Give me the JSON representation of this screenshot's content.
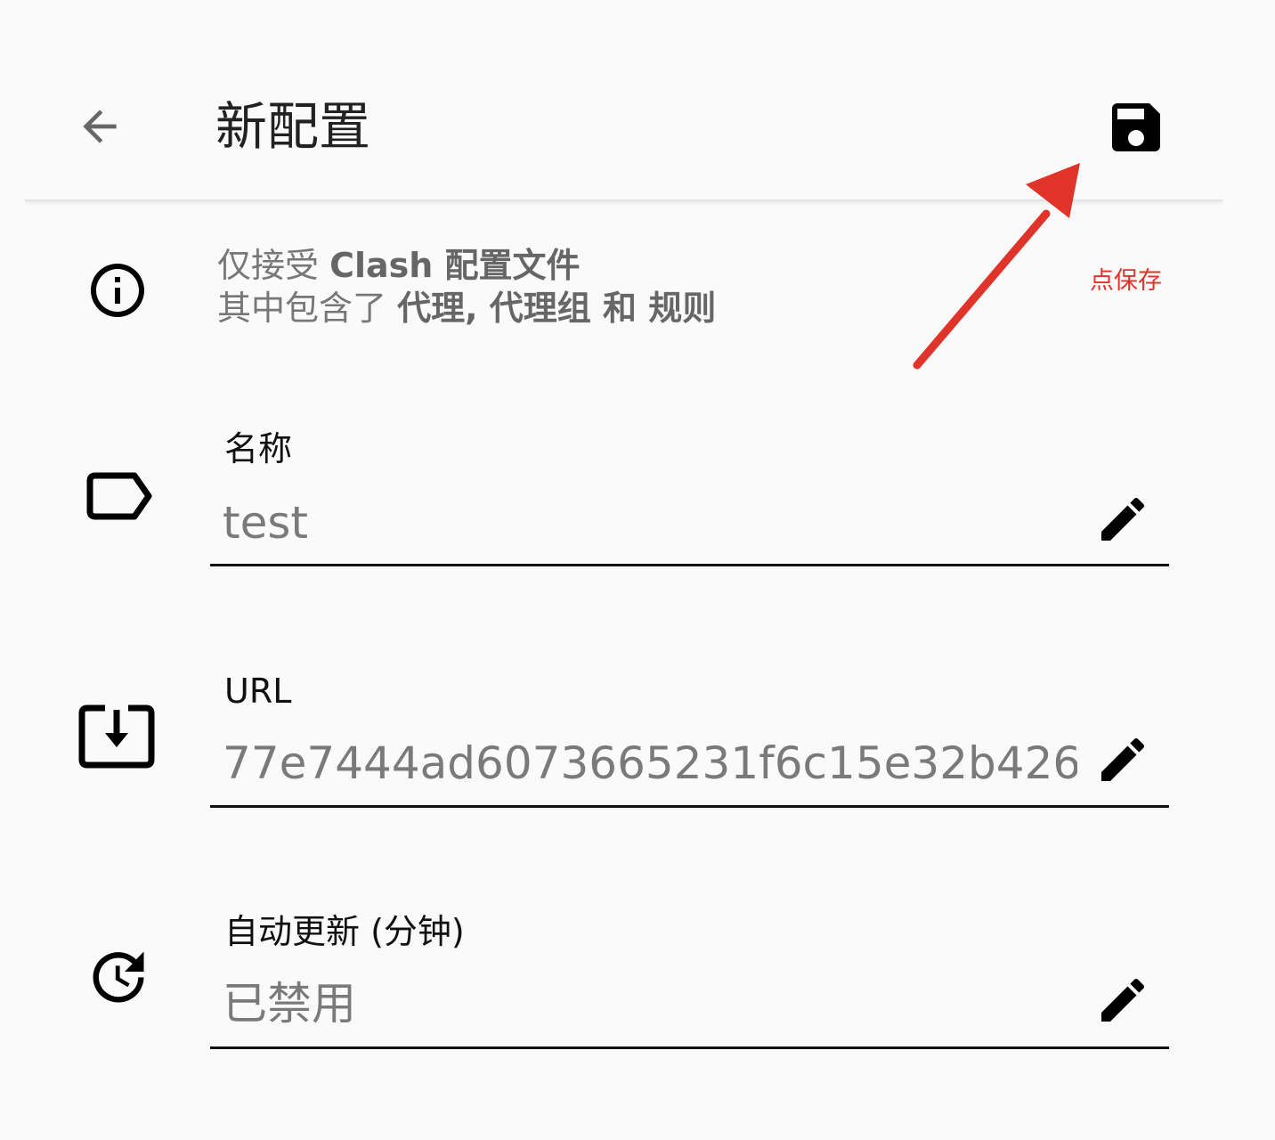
{
  "header": {
    "title": "新配置",
    "back_icon": "arrow-left-icon",
    "save_icon": "floppy-save-icon"
  },
  "info": {
    "icon": "info-circle-icon",
    "line1_prefix": "仅接受 ",
    "line1_bold": "Clash 配置文件",
    "line2_prefix": "其中包含了 ",
    "line2_bold": "代理, 代理组 和 规则"
  },
  "annotation": {
    "label": "点保存",
    "color": "#e0342a"
  },
  "fields": {
    "name": {
      "icon": "label-tag-icon",
      "label": "名称",
      "value": "test"
    },
    "url": {
      "icon": "download-box-icon",
      "label": "URL",
      "value": "77e7444ad6073665231f6c15e32b426..."
    },
    "auto_update": {
      "icon": "clock-update-icon",
      "label": "自动更新 (分钟)",
      "value": "已禁用"
    }
  },
  "colors": {
    "background": "#fafafa",
    "text_primary": "#111111",
    "text_secondary": "#7a7a7a",
    "annotation_red": "#e0342a"
  }
}
